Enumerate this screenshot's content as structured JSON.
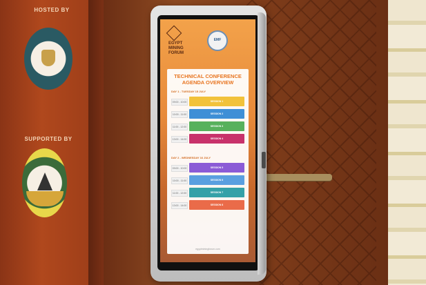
{
  "scene": {
    "left_panel": {
      "hosted_label": "HOSTED BY",
      "supported_label": "SUPPORTED BY",
      "seal1_name": "Ministry of Petroleum & Mineral Resources",
      "seal2_name": "Mineral Resources & Mining Industries Authority"
    },
    "tablet": {
      "logo_text": "EGYPT MINING FORUM",
      "logo_emf": "EMF",
      "title_line1": "TECHNICAL CONFERENCE",
      "title_line2": "AGENDA OVERVIEW",
      "day1_label": "DAY 1 - TUESDAY 15 JULY",
      "day2_label": "DAY 2 - WEDNESDAY 16 JULY",
      "day1_rows": [
        {
          "time": "09:00 - 10:00",
          "session": "SESSION 1",
          "color": "#f2c23a"
        },
        {
          "time": "10:00 - 11:00",
          "session": "SESSION 2",
          "color": "#3e8fd6"
        },
        {
          "time": "11:00 - 12:00",
          "session": "SESSION 3",
          "color": "#57b15c"
        },
        {
          "time": "13:00 - 14:00",
          "session": "SESSION 4",
          "color": "#c8326b"
        }
      ],
      "day2_rows": [
        {
          "time": "09:00 - 10:00",
          "session": "SESSION 5",
          "color": "#8b5bd6"
        },
        {
          "time": "10:00 - 11:00",
          "session": "SESSION 6",
          "color": "#5a9fe0"
        },
        {
          "time": "11:00 - 12:00",
          "session": "SESSION 7",
          "color": "#34a1a8"
        },
        {
          "time": "13:00 - 14:00",
          "session": "SESSION 8",
          "color": "#ea6b49"
        }
      ],
      "footer": "egyptminingforum.com"
    }
  }
}
